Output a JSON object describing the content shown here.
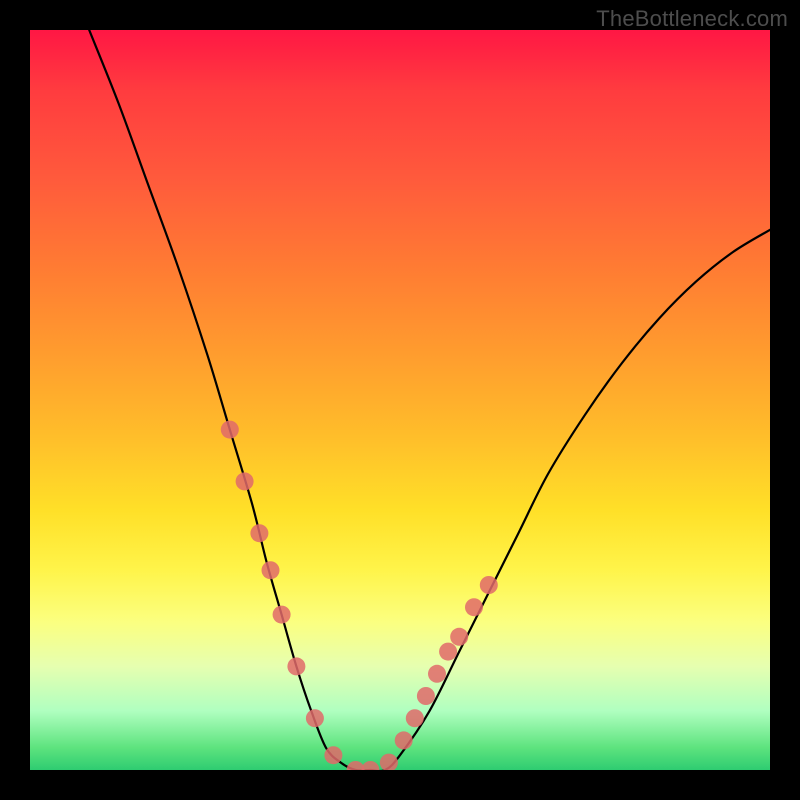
{
  "watermark": "TheBottleneck.com",
  "chart_data": {
    "type": "line",
    "title": "",
    "xlabel": "",
    "ylabel": "",
    "xlim": [
      0,
      100
    ],
    "ylim": [
      0,
      100
    ],
    "series": [
      {
        "name": "bottleneck-curve",
        "x": [
          8,
          12,
          16,
          20,
          24,
          27,
          30,
          32,
          34,
          36,
          38,
          40,
          42,
          44,
          46,
          48,
          50,
          54,
          58,
          62,
          66,
          70,
          75,
          80,
          85,
          90,
          95,
          100
        ],
        "values": [
          100,
          90,
          79,
          68,
          56,
          46,
          36,
          28,
          21,
          14,
          8,
          3,
          1,
          0,
          0,
          0,
          2,
          8,
          16,
          24,
          32,
          40,
          48,
          55,
          61,
          66,
          70,
          73
        ]
      }
    ],
    "markers": {
      "name": "data-points",
      "x": [
        27,
        29,
        31,
        32.5,
        34,
        36,
        38.5,
        41,
        44,
        46,
        48.5,
        50.5,
        52,
        53.5,
        55,
        56.5,
        58,
        60,
        62
      ],
      "values": [
        46,
        39,
        32,
        27,
        21,
        14,
        7,
        2,
        0,
        0,
        1,
        4,
        7,
        10,
        13,
        16,
        18,
        22,
        25
      ]
    },
    "gradient_meaning": "vertical color gradient from red (high bottleneck) at top to green (optimal) at bottom"
  }
}
